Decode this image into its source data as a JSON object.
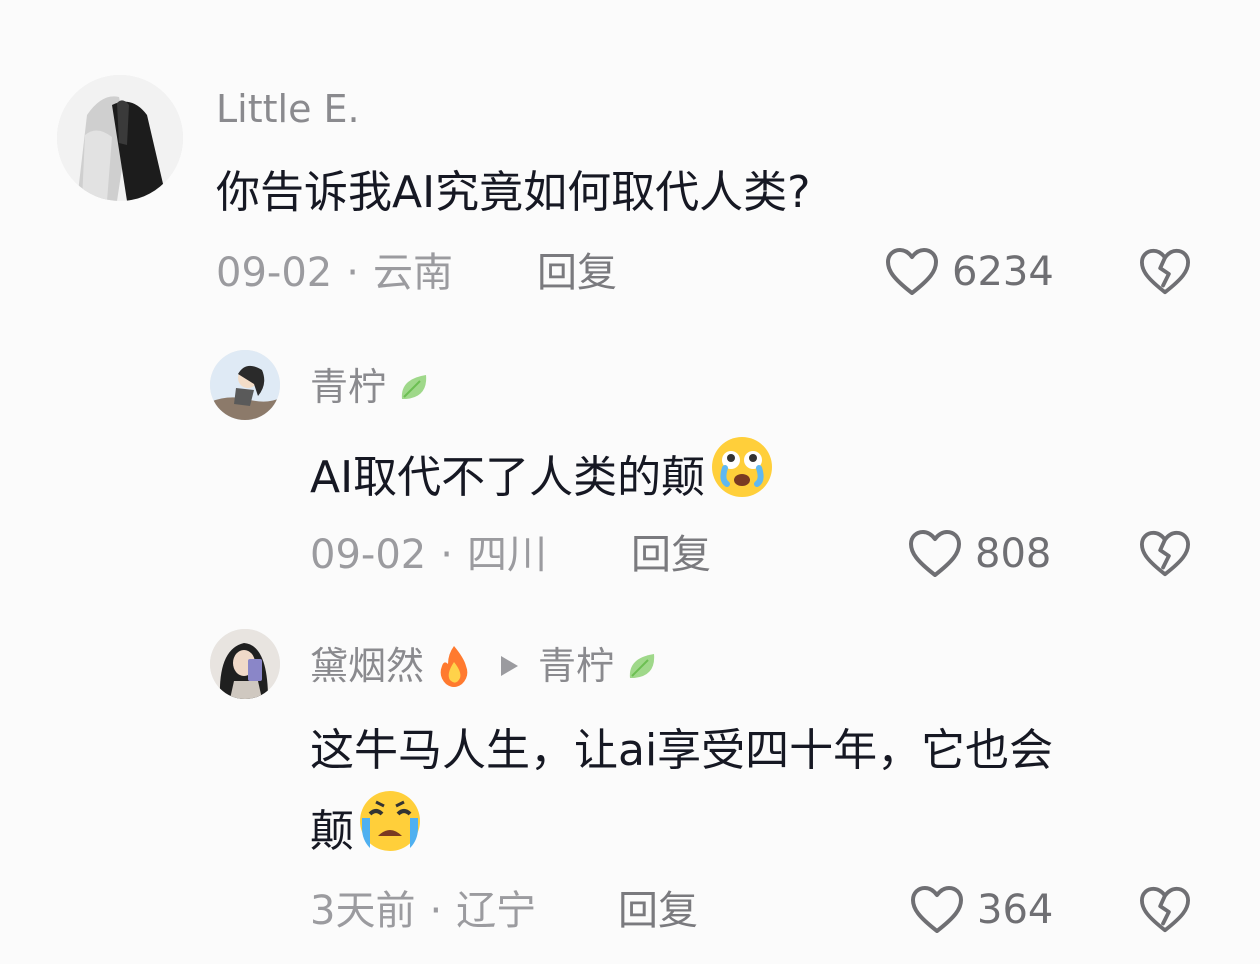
{
  "comments": [
    {
      "user": "Little E.",
      "text": "你告诉我AI究竟如何取代人类?",
      "date": "09-02",
      "sep": "·",
      "location": "云南",
      "reply_label": "回复",
      "likes": "6234"
    },
    {
      "user": "青柠",
      "text": "AI取代不了人类的颠",
      "date": "09-02",
      "sep": "·",
      "location": "四川",
      "reply_label": "回复",
      "likes": "808"
    },
    {
      "user": "黛烟然",
      "reply_to": "青柠",
      "text_line1": "这牛马人生，让ai享受四十年，它也会",
      "text_line2": "颠",
      "date": "3天前",
      "sep": "·",
      "location": "辽宁",
      "reply_label": "回复",
      "likes": "364"
    }
  ],
  "icons": {
    "like": "heart-outline-icon",
    "dislike": "broken-heart-icon",
    "reply_arrow": "play-triangle-icon",
    "leaf": "leaf-icon",
    "fire": "fire-icon",
    "crying_face": "crying-face-emoji",
    "tears_face": "loudly-crying-face-emoji"
  },
  "colors": {
    "background": "#fbfbfb",
    "text": "#161823",
    "muted": "#9b9b9f",
    "icon": "#6f6f73"
  }
}
